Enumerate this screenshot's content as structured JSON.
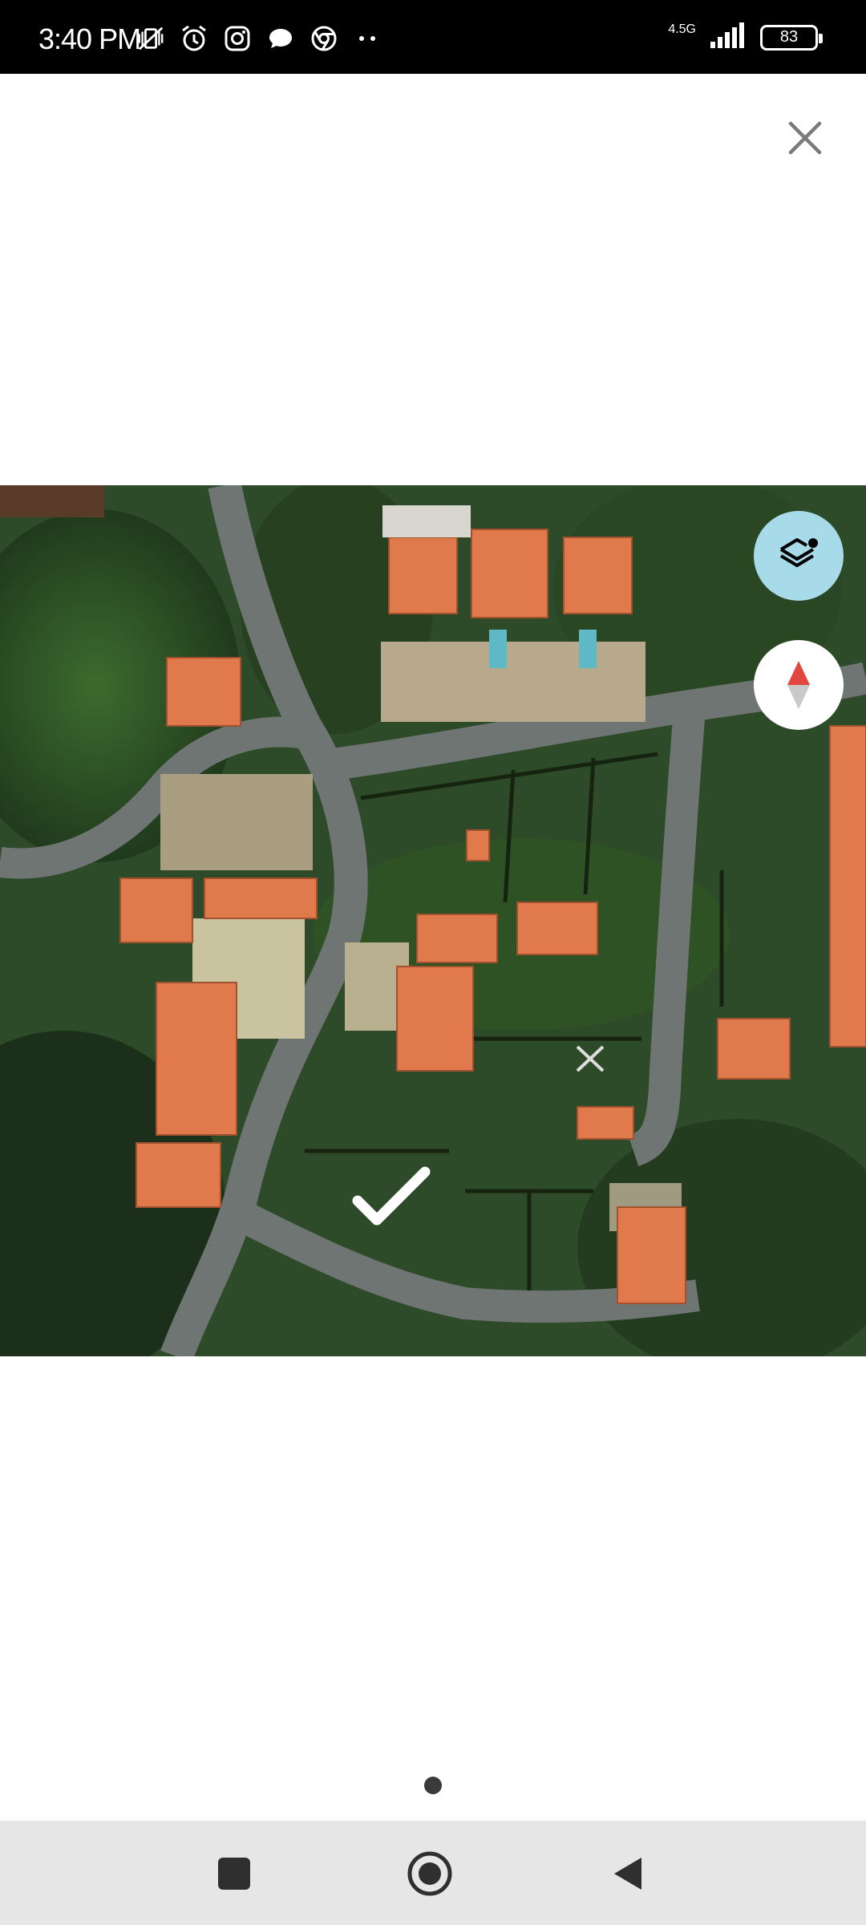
{
  "status_bar": {
    "time": "3:40 PM",
    "network_label": "4.5G",
    "battery_level": "83",
    "icons": [
      "vibrate-off-icon",
      "alarm-icon",
      "instagram-icon",
      "message-icon",
      "chrome-icon",
      "more-dots-icon",
      "signal-icon",
      "battery-icon"
    ]
  },
  "toolbar": {
    "close_icon": "close-icon"
  },
  "map": {
    "view": "satellite",
    "marker_icon": "checkmark-icon",
    "layers_icon": "layers-icon",
    "compass_icon": "compass-icon",
    "accent_color": "#a8dbe9"
  },
  "pager": {
    "active_page": 1
  },
  "navigation_bar": {
    "icons": [
      "recents-square-icon",
      "home-circle-icon",
      "back-triangle-icon"
    ]
  }
}
